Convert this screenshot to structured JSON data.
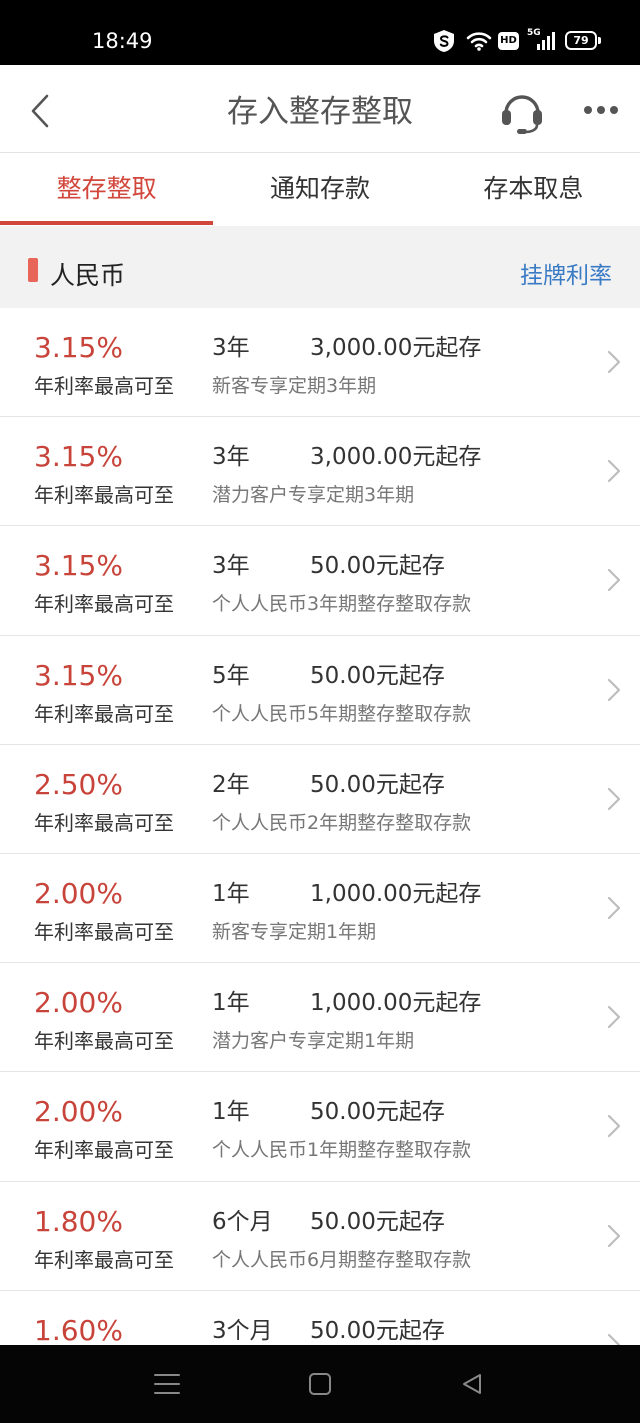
{
  "status_bar": {
    "time": "18:49",
    "hd": "HD",
    "network": "5G",
    "battery": "79",
    "icons": [
      "shield-s-icon",
      "wifi-icon",
      "hd-icon",
      "signal-icon",
      "battery-icon"
    ]
  },
  "header": {
    "title": "存入整存整取",
    "icons": [
      "chevron-left-icon",
      "headset-icon",
      "more-dots-icon"
    ]
  },
  "tabs": [
    {
      "label": "整存整取",
      "active": true
    },
    {
      "label": "通知存款",
      "active": false
    },
    {
      "label": "存本取息",
      "active": false
    }
  ],
  "section": {
    "title": "人民币",
    "link": "挂牌利率"
  },
  "products": [
    {
      "rate": "3.15%",
      "rate_label": "年利率最高可至",
      "term": "3年",
      "min_amount": "3,000.00元起存",
      "name": "新客专享定期3年期"
    },
    {
      "rate": "3.15%",
      "rate_label": "年利率最高可至",
      "term": "3年",
      "min_amount": "3,000.00元起存",
      "name": "潜力客户专享定期3年期"
    },
    {
      "rate": "3.15%",
      "rate_label": "年利率最高可至",
      "term": "3年",
      "min_amount": "50.00元起存",
      "name": "个人人民币3年期整存整取存款"
    },
    {
      "rate": "3.15%",
      "rate_label": "年利率最高可至",
      "term": "5年",
      "min_amount": "50.00元起存",
      "name": "个人人民币5年期整存整取存款"
    },
    {
      "rate": "2.50%",
      "rate_label": "年利率最高可至",
      "term": "2年",
      "min_amount": "50.00元起存",
      "name": "个人人民币2年期整存整取存款"
    },
    {
      "rate": "2.00%",
      "rate_label": "年利率最高可至",
      "term": "1年",
      "min_amount": "1,000.00元起存",
      "name": "新客专享定期1年期"
    },
    {
      "rate": "2.00%",
      "rate_label": "年利率最高可至",
      "term": "1年",
      "min_amount": "1,000.00元起存",
      "name": "潜力客户专享定期1年期"
    },
    {
      "rate": "2.00%",
      "rate_label": "年利率最高可至",
      "term": "1年",
      "min_amount": "50.00元起存",
      "name": "个人人民币1年期整存整取存款"
    },
    {
      "rate": "1.80%",
      "rate_label": "年利率最高可至",
      "term": "6个月",
      "min_amount": "50.00元起存",
      "name": "个人人民币6月期整存整取存款"
    },
    {
      "rate": "1.60%",
      "term": "3个月",
      "min_amount": "50.00元起存"
    }
  ],
  "nav_bar": {
    "icons": [
      "menu-icon",
      "home-icon",
      "back-triangle-icon"
    ]
  },
  "colors": {
    "accent": "#d2473c",
    "rate": "#c8443a",
    "link": "#3a7bc6",
    "section_background": "#f2f2f2",
    "marker": "#e8655a"
  }
}
